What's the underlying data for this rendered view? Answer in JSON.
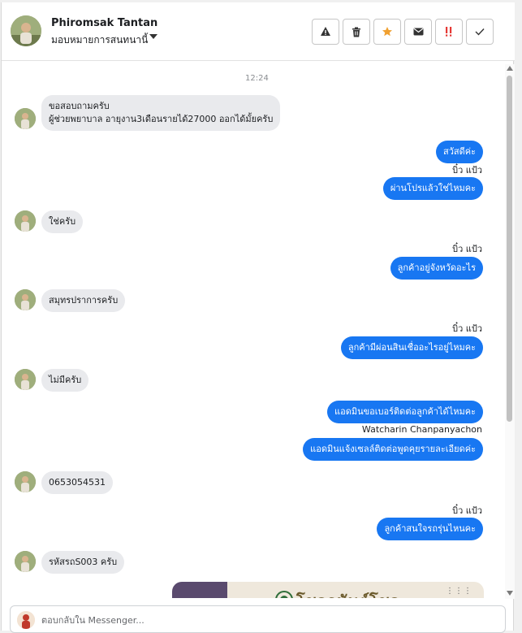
{
  "contact": {
    "name": "Phiromsak Tantan",
    "assign_label": "มอบหมายการสนทนานี้"
  },
  "header_actions": [
    {
      "name": "report-button",
      "icon": "warning-icon"
    },
    {
      "name": "delete-button",
      "icon": "trash-icon"
    },
    {
      "name": "star-button",
      "icon": "star-icon",
      "color": "#f0a030"
    },
    {
      "name": "mark-unread-button",
      "icon": "envelope-icon"
    },
    {
      "name": "follow-up-button",
      "icon": "exclamation-icon",
      "color": "#e53935"
    },
    {
      "name": "mark-done-button",
      "icon": "check-icon"
    }
  ],
  "thread": {
    "time": "12:24",
    "messages": [
      {
        "dir": "in",
        "text": "ขอสอบถามครับ\nผู้ช่วยพยาบาล อายุงาน3เดือนรายได้27000 ออกได้มั้ยครับ"
      },
      {
        "dir": "out",
        "text": "สวัสดีค่ะ"
      },
      {
        "dir": "sender",
        "text": "บิ๋ว แป้ว"
      },
      {
        "dir": "out",
        "text": "ผ่านโปรแล้วใช่ไหมคะ"
      },
      {
        "dir": "in",
        "text": "ใช่ครับ"
      },
      {
        "dir": "sender",
        "text": "บิ๋ว แป้ว"
      },
      {
        "dir": "out",
        "text": "ลูกค้าอยู่จังหวัดอะไร"
      },
      {
        "dir": "in",
        "text": "สมุทรปราการครับ"
      },
      {
        "dir": "sender",
        "text": "บิ๋ว แป้ว"
      },
      {
        "dir": "out",
        "text": "ลูกค้ามีผ่อนสินเชื่ออะไรอยู่ไหมคะ"
      },
      {
        "dir": "in",
        "text": "ไม่มีครับ"
      },
      {
        "dir": "out",
        "text": "แอดมินขอเบอร์ติดต่อลูกค้าได้ไหมคะ"
      },
      {
        "dir": "sender",
        "text": "Watcharin Chanpanyachon"
      },
      {
        "dir": "out",
        "text": "แอดมินแจ้งเซลล์ติดต่อพูดคุยรายละเอียดค่ะ"
      },
      {
        "dir": "in",
        "text": "0653054531"
      },
      {
        "dir": "sender",
        "text": "บิ๋ว แป้ว"
      },
      {
        "dir": "out",
        "text": "ลูกค้าสนใจรถรุ่นไหนคะ"
      },
      {
        "dir": "in",
        "text": "รหัสรถS003 ครับ"
      }
    ],
    "card_text": "โชคอนันต์โชค",
    "card_dots": "⋮⋮⋮"
  },
  "composer": {
    "placeholder": "ตอบกลับใน Messenger..."
  },
  "colors": {
    "outgoing_bubble": "#1877f2",
    "incoming_bubble": "#e9eaed"
  }
}
